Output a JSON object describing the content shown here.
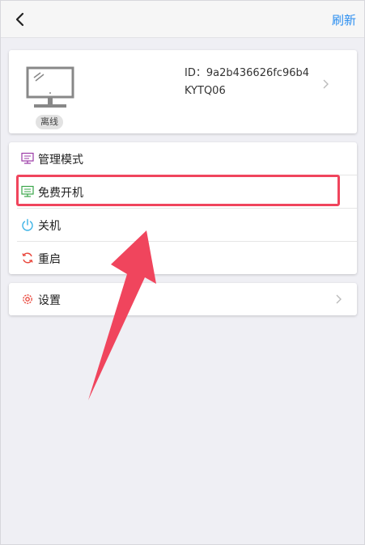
{
  "header": {
    "refresh_label": "刷新",
    "back_icon": "chevron-left-icon"
  },
  "device": {
    "status": "离线",
    "id_text": "ID：9a2b436626fc96b4",
    "name": "KYTQ06",
    "icon": "monitor-icon"
  },
  "menu": {
    "items": [
      {
        "label": "管理模式",
        "icon": "monitor-settings-icon",
        "color": "#9b3aa6"
      },
      {
        "label": "免费开机",
        "icon": "monitor-power-icon",
        "color": "#3aa64a"
      },
      {
        "label": "关机",
        "icon": "power-icon",
        "color": "#3cb3e6"
      },
      {
        "label": "重启",
        "icon": "restart-icon",
        "color": "#e9473c"
      }
    ]
  },
  "settings": {
    "label": "设置",
    "icon": "gear-icon",
    "color": "#e9473c"
  },
  "colors": {
    "accent": "#2b8ef0",
    "highlight": "#f0455d",
    "background": "#efeff4"
  }
}
